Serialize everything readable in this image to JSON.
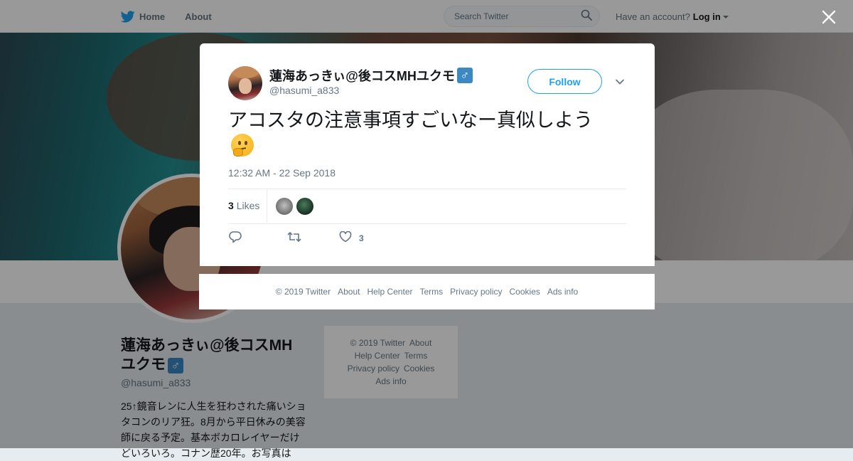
{
  "topbar": {
    "home_label": "Home",
    "about_label": "About",
    "search_placeholder": "Search Twitter",
    "have_account": "Have an account?",
    "login_label": "Log in"
  },
  "profile": {
    "name": "蓮海あっきぃ@後コスMHユクモ",
    "handle": "@hasumi_a833",
    "bio": "25↑鏡音レンに人生を狂わされた痛いショタコンのリア狂。8月から平日休みの美容師に戻る予定。基本ボカロレイヤーだけどいろいろ。コナン歴20年。お写真は"
  },
  "side_footer": {
    "links": [
      "© 2019 Twitter",
      "About",
      "Help Center",
      "Terms",
      "Privacy policy",
      "Cookies",
      "Ads info"
    ]
  },
  "tweet": {
    "author_name": "蓮海あっきぃ@後コスMHユクモ",
    "male_sign": "♂",
    "author_handle": "@hasumi_a833",
    "follow_label": "Follow",
    "text": "アコスタの注意事項すごいなー真似しよう",
    "emoji": "thinking-face-emoji",
    "timestamp": "12:32 AM - 22 Sep 2018",
    "likes_number": "3",
    "likes_label": "Likes",
    "action_like_count": "3"
  },
  "modal_footer": {
    "links": [
      "© 2019 Twitter",
      "About",
      "Help Center",
      "Terms",
      "Privacy policy",
      "Cookies",
      "Ads info"
    ]
  },
  "colors": {
    "accent": "#1da1f2",
    "text": "#14171a",
    "muted": "#657786",
    "badge": "#3b88c3"
  }
}
